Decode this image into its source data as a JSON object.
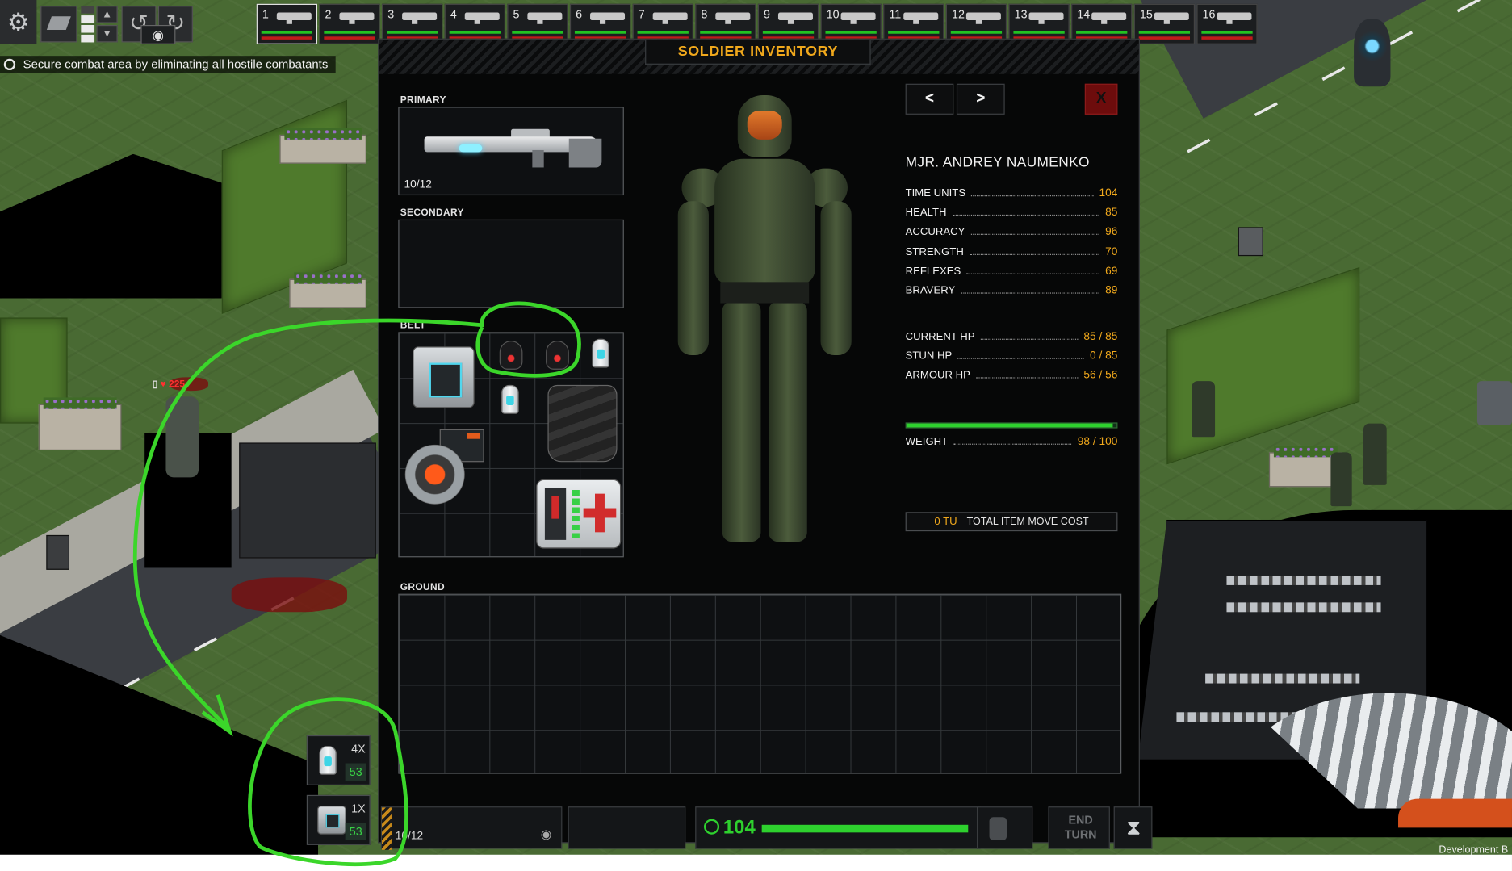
{
  "hud": {
    "gear_icon": "gear-icon",
    "rotate_icons": [
      "rotate-left-icon",
      "rotate-right-icon"
    ],
    "eye_icon": "eye-icon"
  },
  "squad": [
    {
      "number": "1",
      "active": true
    },
    {
      "number": "2"
    },
    {
      "number": "3"
    },
    {
      "number": "4"
    },
    {
      "number": "5"
    },
    {
      "number": "6"
    },
    {
      "number": "7"
    },
    {
      "number": "8"
    },
    {
      "number": "9"
    },
    {
      "number": "10"
    },
    {
      "number": "11"
    },
    {
      "number": "12"
    },
    {
      "number": "13"
    },
    {
      "number": "14"
    },
    {
      "number": "15"
    },
    {
      "number": "16"
    }
  ],
  "objective": {
    "text": "Secure combat area by eliminating all hostile combatants"
  },
  "inventory": {
    "title": "SOLDIER INVENTORY",
    "primary_label": "PRIMARY",
    "primary_ammo": "10/12",
    "secondary_label": "SECONDARY",
    "belt_label": "BELT",
    "ground_label": "GROUND",
    "prev_label": "<",
    "next_label": ">",
    "close_label": "X",
    "soldier_name": "MJR. ANDREY NAUMENKO",
    "stats": [
      {
        "label": "TIME UNITS",
        "value": "104"
      },
      {
        "label": "HEALTH",
        "value": "85"
      },
      {
        "label": "ACCURACY",
        "value": "96"
      },
      {
        "label": "STRENGTH",
        "value": "70"
      },
      {
        "label": "REFLEXES",
        "value": "69"
      },
      {
        "label": "BRAVERY",
        "value": "89"
      }
    ],
    "hp": [
      {
        "label": "CURRENT HP",
        "value": "85 / 85"
      },
      {
        "label": "STUN HP",
        "value": "0 / 85"
      },
      {
        "label": "ARMOUR HP",
        "value": "56 / 56"
      }
    ],
    "weight": {
      "label": "WEIGHT",
      "value": "98 / 100",
      "fraction": 0.98
    },
    "move_cost": {
      "tu": "0 TU",
      "label": "TOTAL ITEM MOVE COST"
    }
  },
  "bottom_bar": {
    "ammo": "10/12",
    "time_units": "104",
    "end_turn": "END\nTURN"
  },
  "quick_slots": [
    {
      "count": "4X",
      "value": "53"
    },
    {
      "count": "1X",
      "value": "53"
    }
  ],
  "enemy_tag": {
    "hp": "225"
  },
  "footer": {
    "build": "Development B"
  },
  "colors": {
    "accent_orange": "#f0a81c",
    "tu_green": "#2ed12e",
    "hp_red": "#c01b1b",
    "annotation_green": "#3bd62a"
  }
}
